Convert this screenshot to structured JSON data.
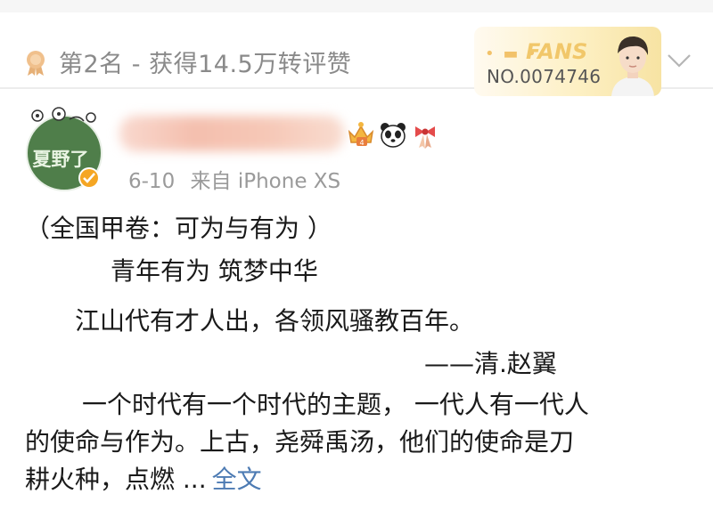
{
  "rank": {
    "text": "第2名 - 获得14.5万转评赞"
  },
  "fans_card": {
    "label": "FANS",
    "number": "NO.0074746"
  },
  "post": {
    "avatar_text": "夏野了",
    "date": "6-10",
    "source": "来自 iPhone XS",
    "lines": [
      "（全国甲卷：可为与有为 ）",
      "青年有为 筑梦中华",
      "江山代有才人出，各领风骚教百年。",
      "——清.赵翼",
      "一个时代有一个时代的主题， 一代人有一代人",
      "的使命与作为。上古，尧舜禹汤，他们的使命是刀",
      "耕火种，点燃 ..."
    ],
    "full_text_link": "全文"
  },
  "colors": {
    "accent_link": "#4d7bb3",
    "rank_text": "#8a8a8a",
    "verified": "#f5a623"
  },
  "icons": [
    "medal-icon",
    "fans-avatar",
    "chevron-down-icon",
    "verified-icon",
    "crown-badge-icon",
    "panda-icon",
    "ribbon-icon"
  ]
}
